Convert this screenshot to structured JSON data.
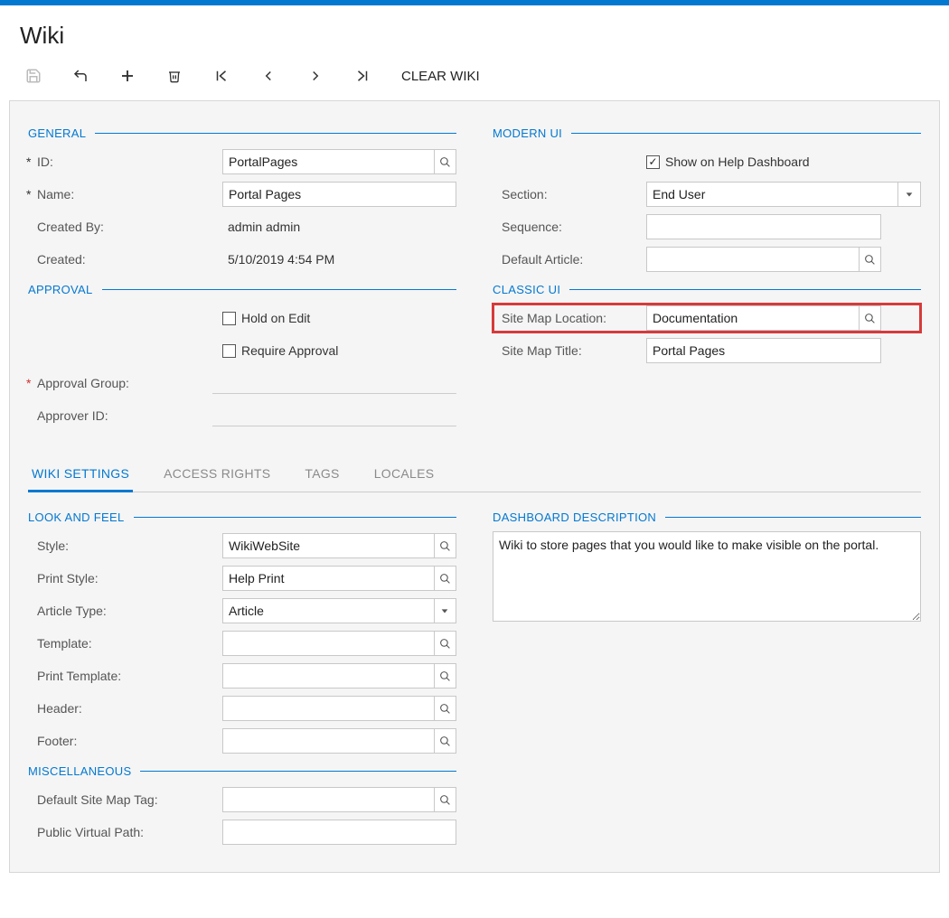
{
  "page_title": "Wiki",
  "toolbar": {
    "clear_wiki": "CLEAR WIKI"
  },
  "sections": {
    "general": "GENERAL",
    "approval": "APPROVAL",
    "modern_ui": "MODERN UI",
    "classic_ui": "CLASSIC UI",
    "look_feel": "LOOK AND FEEL",
    "misc": "MISCELLANEOUS",
    "dashboard_desc": "DASHBOARD DESCRIPTION"
  },
  "labels": {
    "id": "ID:",
    "name": "Name:",
    "created_by": "Created By:",
    "created": "Created:",
    "hold_on_edit": "Hold on Edit",
    "require_approval": "Require Approval",
    "approval_group": "Approval Group:",
    "approver_id": "Approver ID:",
    "show_help": "Show on Help Dashboard",
    "section": "Section:",
    "sequence": "Sequence:",
    "default_article": "Default Article:",
    "sitemap_location": "Site Map Location:",
    "sitemap_title": "Site Map Title:",
    "style": "Style:",
    "print_style": "Print Style:",
    "article_type": "Article Type:",
    "template": "Template:",
    "print_template": "Print Template:",
    "header": "Header:",
    "footer": "Footer:",
    "default_sitemap_tag": "Default Site Map Tag:",
    "public_virtual_path": "Public Virtual Path:"
  },
  "values": {
    "id": "PortalPages",
    "name": "Portal Pages",
    "created_by": "admin admin",
    "created": "5/10/2019 4:54 PM",
    "section": "End User",
    "sequence": "",
    "default_article": "",
    "sitemap_location": "Documentation",
    "sitemap_title": "Portal Pages",
    "style": "WikiWebSite",
    "print_style": "Help Print",
    "article_type": "Article",
    "template": "",
    "print_template": "",
    "header": "",
    "footer": "",
    "default_sitemap_tag": "",
    "public_virtual_path": "",
    "dashboard_description": "Wiki to store pages that you would like to make visible on the portal."
  },
  "checkboxes": {
    "show_help": true,
    "hold_on_edit": false,
    "require_approval": false
  },
  "tabs": {
    "wiki_settings": "WIKI SETTINGS",
    "access_rights": "ACCESS RIGHTS",
    "tags": "TAGS",
    "locales": "LOCALES"
  }
}
